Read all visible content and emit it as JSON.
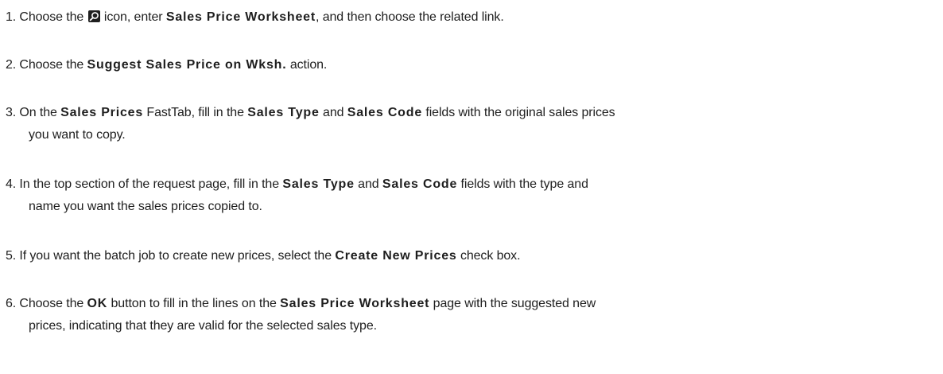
{
  "steps": [
    {
      "number": "1.",
      "t1": "Choose the ",
      "icon": "search-icon",
      "t2": " icon, enter ",
      "b1": "Sales Price Worksheet",
      "t3": ", and then choose the related link."
    },
    {
      "number": "2.",
      "t1": "Choose the ",
      "b1": "Suggest Sales Price on Wksh.",
      "t2": " action."
    },
    {
      "number": "3.",
      "t1": "On the ",
      "b1": "Sales Prices",
      "t2": " FastTab, fill in the ",
      "b2": "Sales Type",
      "t3": " and ",
      "b3": "Sales Code",
      "t4": " fields with the original sales prices",
      "cont": "you want to copy."
    },
    {
      "number": "4.",
      "t1": "In the top section of the request page, fill in the ",
      "b1": "Sales Type",
      "t2": " and ",
      "b2": "Sales Code",
      "t3": " fields with the type and",
      "cont": "name you want the sales prices copied to."
    },
    {
      "number": "5.",
      "t1": "If you want the batch job to create new prices, select the ",
      "b1": "Create New Prices",
      "t2": " check box."
    },
    {
      "number": "6.",
      "t1": "Choose the ",
      "b1": "OK",
      "t2": " button to fill in the lines on the ",
      "b2": "Sales Price Worksheet",
      "t3": " page with the suggested new",
      "cont": "prices, indicating that they are valid for the selected sales type."
    }
  ]
}
